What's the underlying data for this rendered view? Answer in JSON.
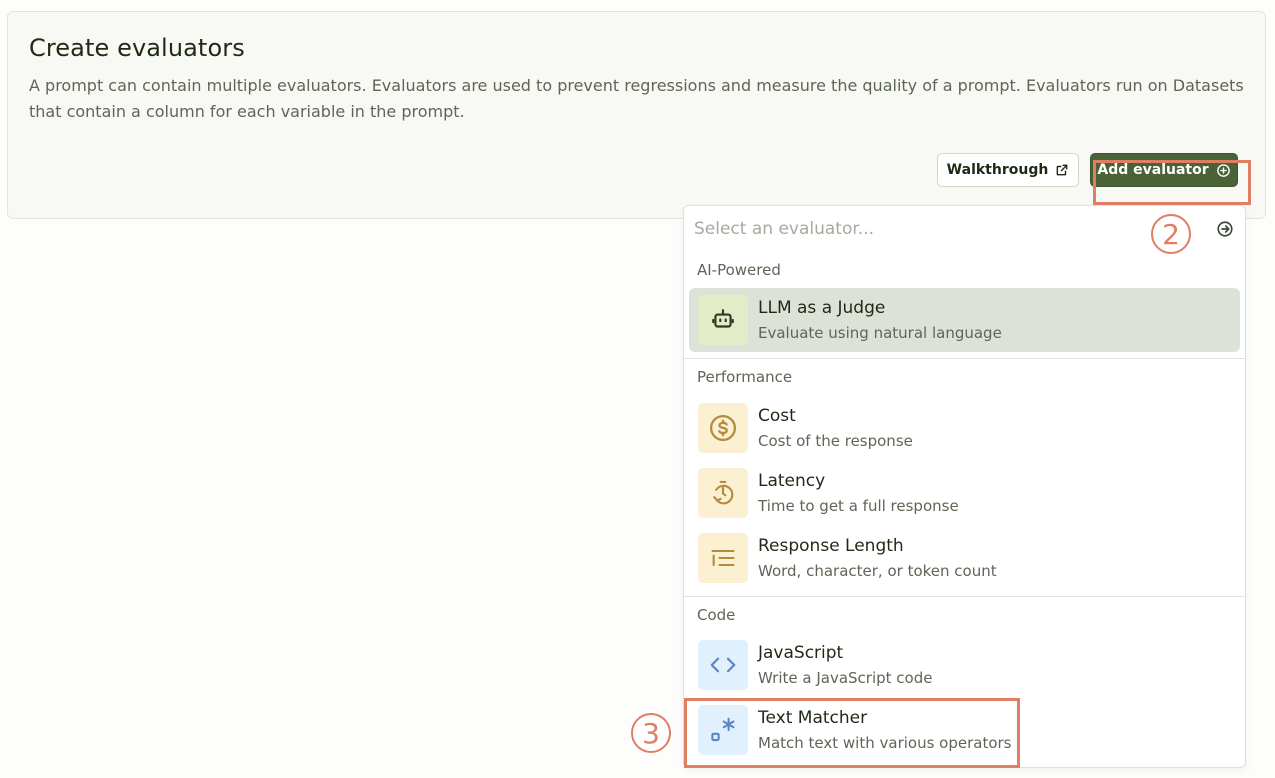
{
  "card": {
    "title": "Create evaluators",
    "description": "A prompt can contain multiple evaluators. Evaluators are used to prevent regressions and measure the quality of a prompt. Evaluators run on Datasets that contain a column for each variable in the prompt.",
    "walkthrough_label": "Walkthrough",
    "add_label": "Add evaluator"
  },
  "dropdown": {
    "search_placeholder": "Select an evaluator...",
    "groups": [
      {
        "label": "AI-Powered",
        "items": [
          {
            "title": "LLM as a Judge",
            "subtitle": "Evaluate using natural language",
            "icon": "robot-icon"
          }
        ]
      },
      {
        "label": "Performance",
        "items": [
          {
            "title": "Cost",
            "subtitle": "Cost of the response",
            "icon": "dollar-icon"
          },
          {
            "title": "Latency",
            "subtitle": "Time to get a full response",
            "icon": "timer-icon"
          },
          {
            "title": "Response Length",
            "subtitle": "Word, character, or token count",
            "icon": "list-indent-icon"
          }
        ]
      },
      {
        "label": "Code",
        "items": [
          {
            "title": "JavaScript",
            "subtitle": "Write a JavaScript code",
            "icon": "code-icon"
          },
          {
            "title": "Text Matcher",
            "subtitle": "Match text with various operators",
            "icon": "regex-icon"
          }
        ]
      }
    ]
  },
  "annotations": {
    "step_2": "2",
    "step_3": "3"
  },
  "colors": {
    "accent_green": "#4a6238",
    "highlight": "#e07e63",
    "ai_icon_bg": "#e3ecc7",
    "performance_icon_bg": "#fbf0d2",
    "code_icon_bg": "#e1f0fd"
  }
}
